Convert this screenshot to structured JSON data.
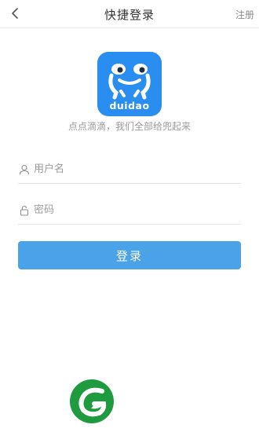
{
  "header": {
    "title": "快捷登录",
    "register_label": "注册",
    "back_icon": "chevron-left-icon"
  },
  "brand": {
    "logo_text": "duidao",
    "logo_color": "#2a8ef0",
    "tagline": "点点滴滴，我们全部给兜起来"
  },
  "form": {
    "username_placeholder": "用户名",
    "username_icon": "user-icon",
    "password_placeholder": "密码",
    "password_icon": "lock-icon",
    "login_label": "登录",
    "button_color": "#4aa3e8"
  },
  "watermark": {
    "icon": "leaf-logo-icon",
    "color": "#1e9b3f"
  }
}
